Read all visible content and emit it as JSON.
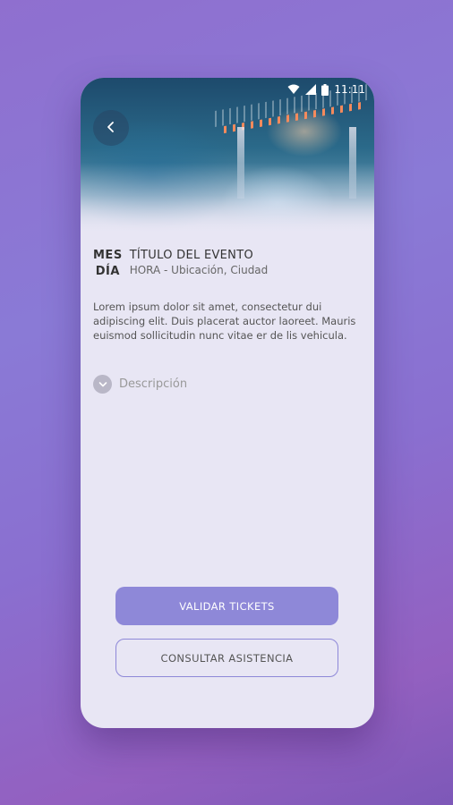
{
  "status_bar": {
    "time": "11:11"
  },
  "event": {
    "date_month": "MES",
    "date_day": "DÍA",
    "title": "TÍTULO DEL EVENTO",
    "subtitle": "HORA - Ubicación, Ciudad",
    "description": "Lorem ipsum dolor sit amet, consectetur dui adipiscing elit. Duis placerat auctor laoreet. Mauris euismod sollicitudin nunc vitae er de lis vehicula.",
    "description_toggle_label": "Descripción"
  },
  "actions": {
    "validate_label": "VALIDAR TICKETS",
    "attendance_label": "CONSULTAR ASISTENCIA"
  },
  "icons": {
    "back": "chevron-left-icon",
    "wifi": "wifi-icon",
    "signal": "signal-icon",
    "battery": "battery-icon",
    "expand": "chevron-down-icon"
  },
  "colors": {
    "accent": "#8e88d8",
    "card_bg": "#e8e6f4"
  }
}
